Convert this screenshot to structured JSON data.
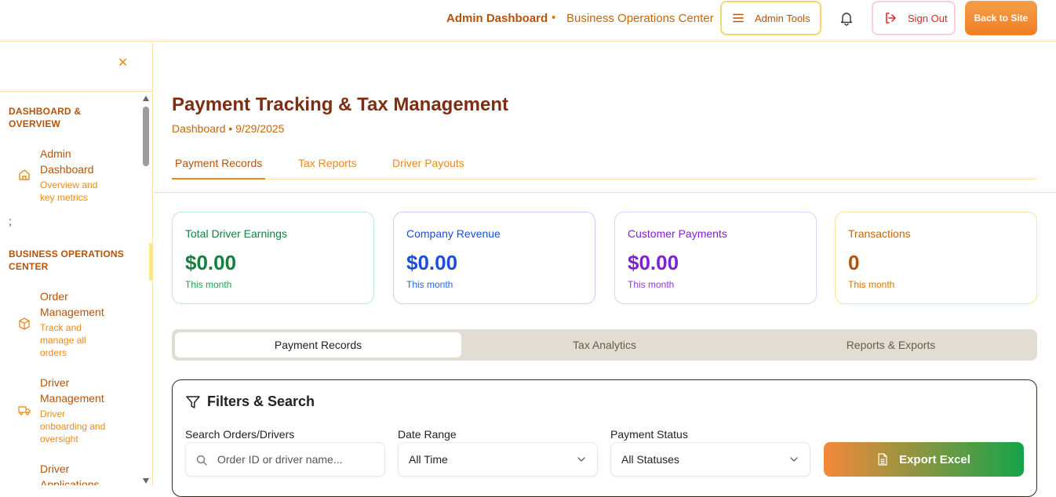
{
  "header": {
    "breadcrumb_primary": "Admin Dashboard",
    "breadcrumb_separator": "•",
    "breadcrumb_secondary": "Business Operations Center",
    "admin_tools_label": "Admin Tools",
    "sign_out_label": "Sign Out",
    "back_to_site_label": "Back to Site"
  },
  "sidebar": {
    "close_glyph": "✕",
    "stray_text": ";",
    "sections": [
      {
        "heading": "DASHBOARD & OVERVIEW",
        "items": [
          {
            "title": "Admin Dashboard",
            "desc": "Overview and key metrics",
            "icon": "home-icon"
          }
        ]
      },
      {
        "heading": "BUSINESS OPERATIONS CENTER",
        "items": [
          {
            "title": "Order Management",
            "desc": "Track and manage all orders",
            "icon": "package-icon"
          },
          {
            "title": "Driver Management",
            "desc": "Driver onboarding and oversight",
            "icon": "truck-icon"
          },
          {
            "title": "Driver Applications",
            "desc": "",
            "icon": ""
          }
        ]
      }
    ]
  },
  "main": {
    "title": "Payment Tracking & Tax Management",
    "subline": "Dashboard • 9/29/2025",
    "tabs": [
      {
        "label": "Payment Records",
        "active": true
      },
      {
        "label": "Tax Reports",
        "active": false
      },
      {
        "label": "Driver Payouts",
        "active": false
      }
    ],
    "stats": [
      {
        "label": "Total Driver Earnings",
        "value": "$0.00",
        "sub": "This month",
        "color": "#15803d"
      },
      {
        "label": "Company Revenue",
        "value": "$0.00",
        "sub": "This month",
        "color": "#1d4ed8"
      },
      {
        "label": "Customer Payments",
        "value": "$0.00",
        "sub": "This month",
        "color": "#7e22ce"
      },
      {
        "label": "Transactions",
        "value": "0",
        "sub": "This month",
        "color": "#c2680c"
      }
    ],
    "segments": [
      {
        "label": "Payment Records",
        "active": true
      },
      {
        "label": "Tax Analytics",
        "active": false
      },
      {
        "label": "Reports & Exports",
        "active": false
      }
    ],
    "filters": {
      "title": "Filters & Search",
      "search_label": "Search Orders/Drivers",
      "search_placeholder": "Order ID or driver name...",
      "date_label": "Date Range",
      "date_value": "All Time",
      "status_label": "Payment Status",
      "status_value": "All Statuses",
      "export_label": "Export Excel"
    }
  },
  "colors": {
    "accent": "#ea8a1a",
    "title": "#7c2d12",
    "border_warm": "#fbe3a0"
  }
}
